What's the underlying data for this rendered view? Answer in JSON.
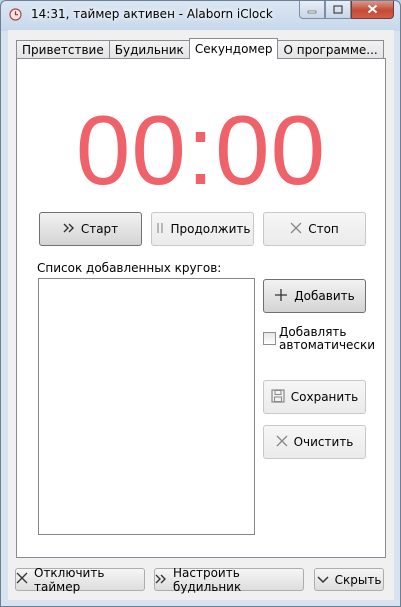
{
  "window": {
    "title": "14:31, таймер активен - Alaborn iClock",
    "icons": {
      "app": "clock-icon",
      "minimize": "minimize-icon",
      "maximize": "maximize-icon",
      "close": "close-icon"
    }
  },
  "tabs": [
    {
      "label": "Приветствие"
    },
    {
      "label": "Будильник"
    },
    {
      "label": "Секундомер"
    },
    {
      "label": "О программе..."
    }
  ],
  "stopwatch": {
    "display": "00:00",
    "display_color": "#f0626a",
    "start_label": "Старт",
    "continue_label": "Продолжить",
    "stop_label": "Стоп"
  },
  "laps": {
    "list_label": "Список добавленных кругов:",
    "items": [],
    "add_label": "Добавить",
    "auto_add_label_line1": "Добавлять",
    "auto_add_label_line2": "автоматически",
    "auto_add_checked": false,
    "save_label": "Сохранить",
    "clear_label": "Очистить"
  },
  "footer": {
    "disable_timer_label": "Отключить таймер",
    "setup_alarm_label": "Настроить будильник",
    "hide_label": "Скрыть"
  }
}
